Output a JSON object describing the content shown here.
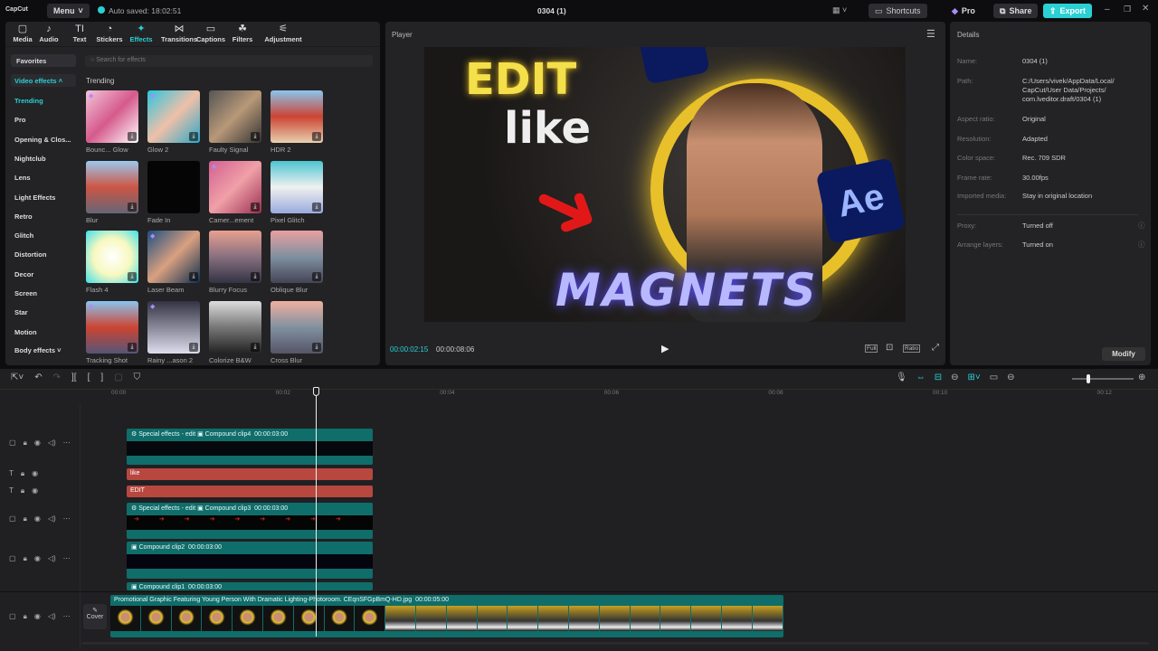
{
  "app": {
    "logo": "CapCut",
    "menu": "Menu",
    "autosave": "Auto saved: 18:02:51",
    "title": "0304 (1)",
    "shortcuts": "Shortcuts",
    "pro": "Pro",
    "share": "Share",
    "export": "Export",
    "accent": "#2ad0d4"
  },
  "toolbar": [
    {
      "icon": "▢",
      "label": "Media"
    },
    {
      "icon": "♪",
      "label": "Audio"
    },
    {
      "icon": "TI",
      "label": "Text"
    },
    {
      "icon": "◔",
      "label": "Stickers"
    },
    {
      "icon": "✦",
      "label": "Effects"
    },
    {
      "icon": "⋈",
      "label": "Transitions"
    },
    {
      "icon": "▭",
      "label": "Captions"
    },
    {
      "icon": "☘",
      "label": "Filters"
    },
    {
      "icon": "⚟",
      "label": "Adjustment"
    }
  ],
  "sidebar": {
    "favorites": "Favorites",
    "video_effects": "Video effects",
    "items": [
      "Trending",
      "Pro",
      "Opening & Clos...",
      "Nightclub",
      "Lens",
      "Light Effects",
      "Retro",
      "Glitch",
      "Distortion",
      "Decor",
      "Screen",
      "Star",
      "Motion"
    ],
    "body_effects": "Body effects"
  },
  "search": {
    "placeholder": "Search for effects"
  },
  "section": "Trending",
  "effects": [
    {
      "label": "Bounc... Glow",
      "bg": "linear-gradient(135deg,#f3c5d9,#d55a8c,#fff)"
    },
    {
      "label": "Glow 2",
      "bg": "linear-gradient(135deg,#2ac6e0,#f0c0a8,#2aa8c8)"
    },
    {
      "label": "Faulty Signal",
      "bg": "linear-gradient(135deg,#555,#b89878,#333)"
    },
    {
      "label": "HDR 2",
      "bg": "linear-gradient(180deg,#8bc5ef,#c43,#e8d0b0)"
    },
    {
      "label": "Blur",
      "bg": "linear-gradient(180deg,#9cc8ef,#c54,#667)"
    },
    {
      "label": "Fade In",
      "bg": "#050505"
    },
    {
      "label": "Camer...ement",
      "bg": "linear-gradient(135deg,#d26090,#f0a0a8,#9a3050)"
    },
    {
      "label": "Pixel Glitch",
      "bg": "linear-gradient(180deg,#4cc4d0,#f0f0f0,#9ad)"
    },
    {
      "label": "Flash 4",
      "bg": "radial-gradient(#fff,#f8f8c0,#3ce0e8)"
    },
    {
      "label": "Laser Beam",
      "bg": "linear-gradient(135deg,#1d4e80,#d9a080,#0e3050)"
    },
    {
      "label": "Blurry Focus",
      "bg": "linear-gradient(180deg,#e8a090,#887080,#334)"
    },
    {
      "label": "Oblique Blur",
      "bg": "linear-gradient(180deg,#e8a0a0,#8090a0,#445)"
    },
    {
      "label": "Tracking Shot",
      "bg": "linear-gradient(180deg,#8bc5ef,#c43,#557)"
    },
    {
      "label": "Rainy ...ason 2",
      "bg": "linear-gradient(180deg,#334,#889,#dde)"
    },
    {
      "label": "Colorize B&W",
      "bg": "linear-gradient(180deg,#ddd,#777,#222)"
    },
    {
      "label": "Cross Blur",
      "bg": "linear-gradient(180deg,#f0b0a0,#8090a0,#556)"
    }
  ],
  "player": {
    "title": "Player",
    "current": "00:00:02:15",
    "total": "00:00:08:06",
    "full": "Full",
    "ratio": "Ratio",
    "overlay": {
      "edit": "EDIT",
      "like": "like",
      "magnets": "MAGNETS",
      "ae": "Ae"
    }
  },
  "details": {
    "title": "Details",
    "rows": [
      {
        "k": "Name:",
        "v": "0304 (1)"
      },
      {
        "k": "Path:",
        "v": "C:/Users/vivek/AppData/Local/ CapCut/User Data/Projects/ com.lveditor.draft/0304 (1)"
      },
      {
        "k": "Aspect ratio:",
        "v": "Original"
      },
      {
        "k": "Resolution:",
        "v": "Adapted"
      },
      {
        "k": "Color space:",
        "v": "Rec. 709 SDR"
      },
      {
        "k": "Frame rate:",
        "v": "30.00fps"
      },
      {
        "k": "Imported media:",
        "v": "Stay in original location"
      },
      {
        "k": "Proxy:",
        "v": "Turned off"
      },
      {
        "k": "Arrange layers:",
        "v": "Turned on"
      }
    ],
    "modify": "Modify"
  },
  "timeline": {
    "ruler": [
      "00:00",
      "00:02",
      "00:04",
      "00:06",
      "00:08",
      "00:10",
      "00:12"
    ],
    "clip4": {
      "effect": "Special effects - edit",
      "name": "Compound clip4",
      "dur": "00:00:03:00"
    },
    "text1": "like",
    "text2": "EDIT",
    "clip3": {
      "effect": "Special effects - edit",
      "name": "Compound clip3",
      "dur": "00:00:03:00"
    },
    "clip2": {
      "name": "Compound clip2",
      "dur": "00:00:03:00"
    },
    "clip1": {
      "name": "Compound clip1",
      "dur": "00:00:03:00"
    },
    "main": {
      "name": "Promotional Graphic Featuring Young Person With Dramatic Lighting-Photoroom.",
      "file": "CEqnSFGpBmQ-HD.jpg",
      "dur": "00:00:05:00",
      "cover": "Cover"
    }
  }
}
